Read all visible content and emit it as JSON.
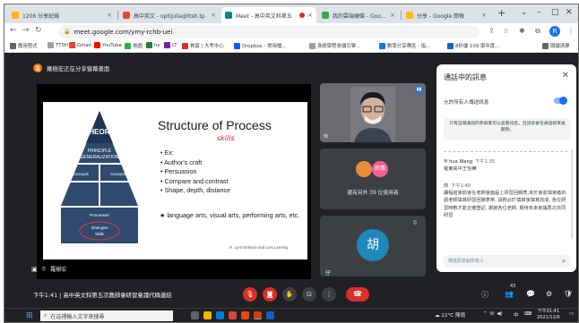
{
  "browser": {
    "tabs": [
      {
        "label": "1206 分享紀錄",
        "active": false
      },
      {
        "label": "高中英文 - optijulia@ttsh.tp",
        "active": false
      },
      {
        "label": "Meet - 高中英文科第五",
        "active": true
      },
      {
        "label": "我的雲端硬碟 - Google 雲端",
        "active": false
      },
      {
        "label": "分享 - Google 簡報",
        "active": false
      }
    ],
    "url": "meet.google.com/ymy-rchb-uei",
    "profile_initial": "R",
    "bookmarks": [
      "應用程式",
      "TTSH",
      "Gmail",
      "YouTube",
      "地圖",
      "hy",
      "LT",
      "首頁 | 大考中心",
      "Dropbox - 常用檔...",
      "身經學程參讀引擎...",
      "數學分享專區 - 指...",
      "8折優 109 學年度..."
    ],
    "bookmarks_other": "閱讀清單",
    "colors": {
      "tab_bar": "#dee1e6",
      "meet_bg": "#202124",
      "accent": "#1a73e8",
      "hangup": "#d93025"
    }
  },
  "meet": {
    "presenting_text": "羅樹宏正在分享螢幕畫面",
    "presenter_name": "羅樹宏",
    "slide": {
      "title": "Structure of Process",
      "handwriting": "skills",
      "bullets": [
        "Ex:",
        "Author's craft",
        "Persuasion",
        "Compare and contrast",
        "Shape, depth, distance"
      ],
      "star_text": "★ language arts, visual arts, performing arts, etc.",
      "credit": "H. Lynn Erikson and Lois Lanning",
      "pyramid": {
        "theory": "THEORY",
        "principle": "PRINCIPLE",
        "generalization": "GENERALIZATION",
        "concepts": "Concepts",
        "processes": "Processes",
        "strategies": "Strategies",
        "skills": "Skills"
      }
    },
    "camera_label": "你",
    "others_label": "還有另外 39 位使用者",
    "others_badge": "鈴惠",
    "hu_initial": "胡",
    "small_name": "仔",
    "meeting_info": "下午1:41 | 高中英文科第五次教師會研習會議代碼連結",
    "participant_count": "43"
  },
  "chat": {
    "title": "通話中的訊息",
    "allow_label": "允許所有人傳送訊息",
    "notice": "只有這場通話的參與者可以查看訊息，且訊息會在通話結束後刪除。",
    "messages": [
      {
        "sender": "Yi hua Wang",
        "time": "下午1:35",
        "text": "羅東高中王怡樺"
      },
      {
        "sender": "你",
        "time": "下午1:40",
        "text": "課程結束前會在老師會面設上研習回饋表,未於會前填寫者的請老師填寫研習回饋表單, 請務必於填寫後填寫完成, 各位研習時數才能正確登記, 謝謝各位老師, 期待未來會議再次共同研習"
      }
    ],
    "input_placeholder": "傳送訊息給所有人"
  },
  "taskbar": {
    "search_placeholder": "在這裡輸入文字來搜尋",
    "weather": "22°C 陣雨",
    "ime": "中",
    "time": "下午01:41",
    "date": "2021/12/6"
  }
}
